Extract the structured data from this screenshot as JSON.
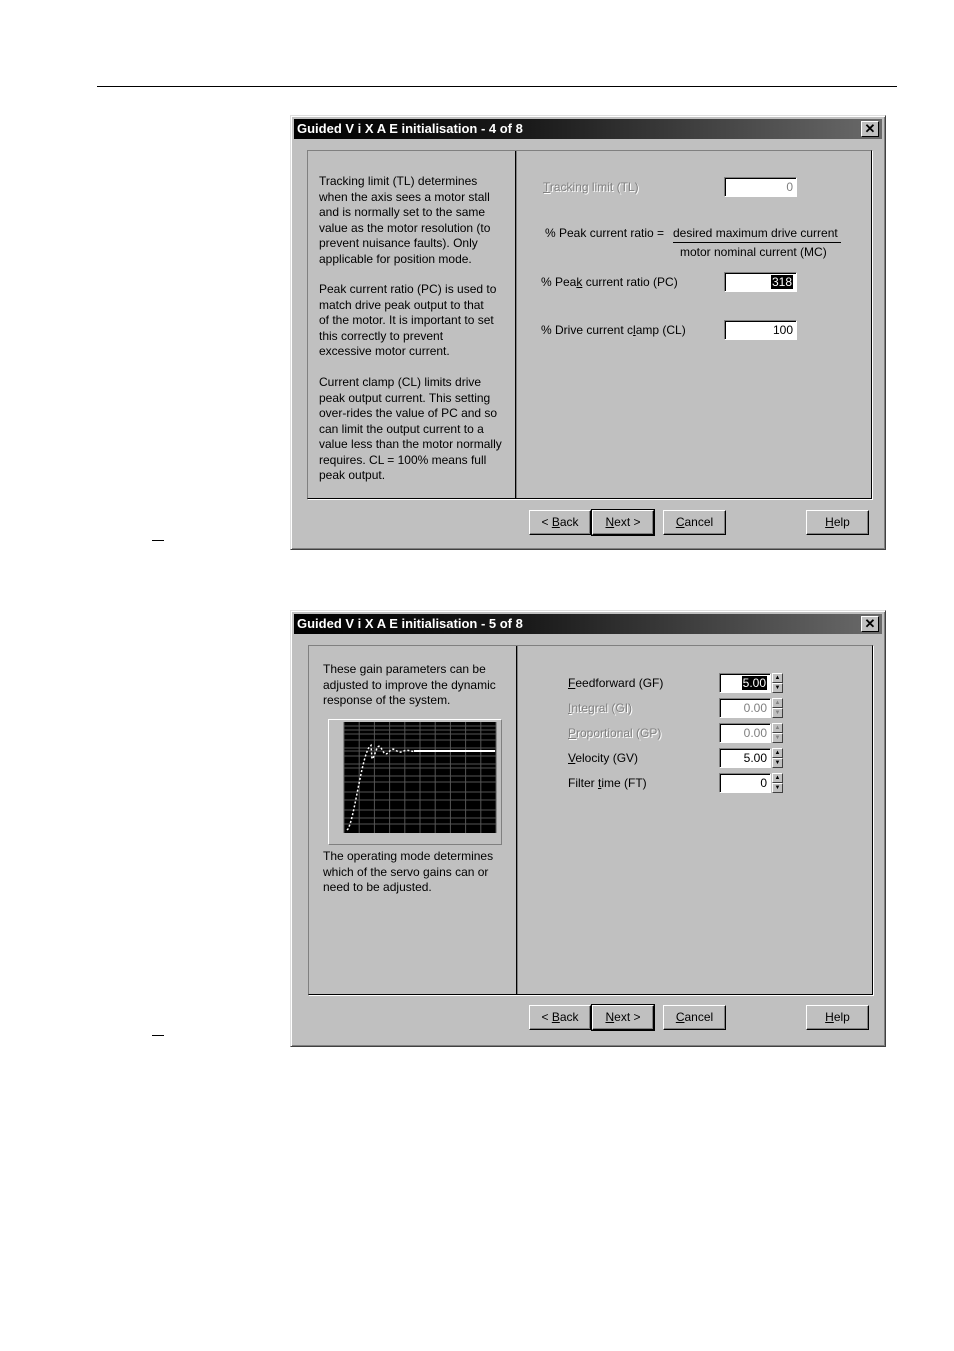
{
  "dialogs": [
    {
      "title": "Guided V i X A E initialisation - 4 of 8",
      "description": [
        "Tracking limit (TL) determines\nwhen the axis sees a motor stall\nand is normally set to the same\nvalue as the motor resolution (to\nprevent nuisance faults). Only\napplicable for position mode.",
        "Peak current ratio (PC) is used to\nmatch drive peak output to that\nof the motor. It is important to set\nthis correctly to prevent\nexcessive motor current.",
        "Current clamp (CL) limits drive\npeak output current. This setting\nover-rides the value of PC and so\ncan limit the output current to a\nvalue less than the motor normally\nrequires. CL = 100% means full\npeak output."
      ],
      "formula": {
        "lhs": "% Peak current ratio = ",
        "numerator": "desired maximum drive current",
        "denominator": "motor nominal current (MC)"
      },
      "fields": [
        {
          "label_pre": "",
          "label_u": "T",
          "label_post": "racking limit (TL)",
          "value": "0",
          "enabled": false,
          "selected": false
        },
        {
          "label_pre": "% Pea",
          "label_u": "k",
          "label_post": " current ratio (PC)",
          "value": "318",
          "enabled": true,
          "selected": true
        },
        {
          "label_pre": "% Drive current c",
          "label_u": "l",
          "label_post": "amp (CL)",
          "value": "100",
          "enabled": true,
          "selected": false
        }
      ],
      "buttons": {
        "back": {
          "pre": "< ",
          "u": "B",
          "post": "ack"
        },
        "next": {
          "pre": "",
          "u": "N",
          "post": "ext >"
        },
        "cancel": {
          "pre": "",
          "u": "C",
          "post": "ancel"
        },
        "help": {
          "pre": "",
          "u": "H",
          "post": "elp"
        }
      }
    },
    {
      "title": "Guided V i X A E initialisation - 5 of 8",
      "description_top": "These gain parameters can be\nadjusted to improve the dynamic\nresponse of the system.",
      "description_bottom": "The operating mode determines\nwhich of the servo gains can or\nneed to be adjusted.",
      "graph": {
        "kind": "step-response",
        "background": "#000000",
        "trace_color": "#ffffff"
      },
      "fields": [
        {
          "label_pre": "",
          "label_u": "F",
          "label_post": "eedforward (GF)",
          "value": "5.00",
          "enabled": true,
          "selected": true
        },
        {
          "label_pre": "",
          "label_u": "I",
          "label_post": "ntegral (GI)",
          "value": "0.00",
          "enabled": false,
          "selected": false
        },
        {
          "label_pre": "",
          "label_u": "P",
          "label_post": "roportional (GP)",
          "value": "0.00",
          "enabled": false,
          "selected": false
        },
        {
          "label_pre": "",
          "label_u": "V",
          "label_post": "elocity (GV)",
          "value": "5.00",
          "enabled": true,
          "selected": false
        },
        {
          "label_pre": "Filter ",
          "label_u": "t",
          "label_post": "ime (FT)",
          "value": "0",
          "enabled": true,
          "selected": false
        }
      ],
      "buttons": {
        "back": {
          "pre": "< ",
          "u": "B",
          "post": "ack"
        },
        "next": {
          "pre": "",
          "u": "N",
          "post": "ext >"
        },
        "cancel": {
          "pre": "",
          "u": "C",
          "post": "ancel"
        },
        "help": {
          "pre": "",
          "u": "H",
          "post": "elp"
        }
      }
    }
  ],
  "icons": {
    "close": "close-icon",
    "spin_up": "spin-up-arrow-icon",
    "spin_down": "spin-down-arrow-icon"
  }
}
